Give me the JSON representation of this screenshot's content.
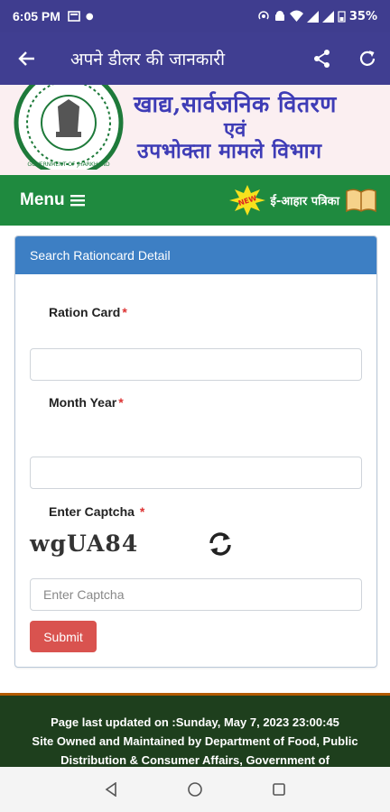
{
  "status_bar": {
    "time": "6:05 PM",
    "battery": "35%"
  },
  "app_bar": {
    "title": "अपने डीलर की जानकारी"
  },
  "banner": {
    "line1": "खाद्य,सार्वजनिक वितरण",
    "line2": "एवं",
    "line3": "उपभोक्ता मामले विभाग",
    "emblem_text": "GOVERNMENT OF JHARKHAND"
  },
  "menu_bar": {
    "menu_label": "Menu",
    "badge": "NEW",
    "epatrika_label": "ई-आहार पत्रिका"
  },
  "form": {
    "header": "Search Rationcard Detail",
    "ration_card_label": "Ration Card",
    "month_year_label": "Month Year",
    "captcha_label": "Enter Captcha",
    "required_marker": "*",
    "captcha_text": "wgUA84",
    "captcha_placeholder": "Enter Captcha",
    "submit_label": "Submit"
  },
  "footer": {
    "updated": "Page last updated on :Sunday, May 7, 2023 23:00:45",
    "owner_1": "Site Owned and Maintained by Department of Food, Public",
    "owner_2": "Distribution & Consumer Affairs, Government of"
  },
  "colors": {
    "app_bar": "#403e91",
    "menu_bar": "#1f8a3f",
    "card_header": "#3d7fc4",
    "submit": "#d9534f",
    "footer": "#1e3f1d"
  }
}
